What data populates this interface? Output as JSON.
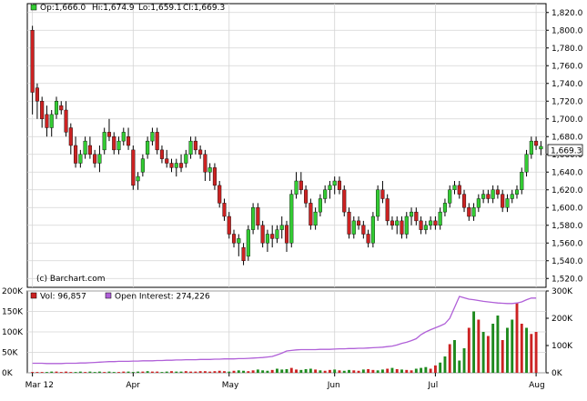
{
  "chart_data": {
    "type": "candlestick",
    "header": {
      "open": "Op:1,666.0",
      "high": "Hi:1,674.9",
      "low": "Lo:1,659.1",
      "close": "Cl:1,669.3"
    },
    "watermark": "(c) Barchart.com",
    "last_price_label": "1,669.3",
    "price_axis": {
      "ylim": [
        1510,
        1830
      ],
      "ticks": [
        1520,
        1540,
        1560,
        1580,
        1600,
        1620,
        1640,
        1660,
        1680,
        1700,
        1720,
        1740,
        1760,
        1780,
        1800,
        1820
      ],
      "tick_labels": [
        "1,520.0",
        "1,540.0",
        "1,560.0",
        "1,580.0",
        "1,600.0",
        "1,620.0",
        "1,640.0",
        "1,660.0",
        "1,680.0",
        "1,700.0",
        "1,720.0",
        "1,740.0",
        "1,760.0",
        "1,780.0",
        "1,800.0",
        "1,820.0"
      ],
      "gridlines": true
    },
    "x_axis": {
      "month_labels": [
        "Mar 12",
        "Apr",
        "May",
        "Jun",
        "Jul",
        "Aug"
      ],
      "month_start_index": [
        0,
        21,
        41,
        63,
        84,
        105
      ]
    },
    "volume_panel": {
      "vol_label": "Vol: 96,857",
      "oi_label": "Open Interest: 274,226",
      "left_ticks": [
        "0K",
        "50K",
        "100K",
        "150K",
        "200K"
      ],
      "left_values": [
        0,
        50000,
        100000,
        150000,
        200000
      ],
      "right_ticks": [
        "0K",
        "100K",
        "200K",
        "300K"
      ],
      "right_values": [
        0,
        100000,
        200000,
        300000
      ],
      "vol_color_up": "#1e8a1e",
      "vol_color_down": "#cc2222",
      "oi_color": "#b060d8"
    },
    "colors": {
      "up": "#33cc33",
      "down": "#cc2222",
      "grid": "#d4d4d4",
      "oi": "#b060d8"
    },
    "candles": [
      [
        1800,
        1805,
        1705,
        1730
      ],
      [
        1735,
        1740,
        1700,
        1720
      ],
      [
        1720,
        1725,
        1690,
        1700
      ],
      [
        1705,
        1715,
        1680,
        1690
      ],
      [
        1690,
        1710,
        1680,
        1705
      ],
      [
        1705,
        1725,
        1700,
        1720
      ],
      [
        1715,
        1720,
        1705,
        1710
      ],
      [
        1710,
        1720,
        1680,
        1685
      ],
      [
        1690,
        1695,
        1660,
        1670
      ],
      [
        1670,
        1680,
        1645,
        1650
      ],
      [
        1650,
        1665,
        1645,
        1660
      ],
      [
        1660,
        1680,
        1655,
        1675
      ],
      [
        1670,
        1680,
        1655,
        1660
      ],
      [
        1660,
        1665,
        1645,
        1650
      ],
      [
        1650,
        1670,
        1640,
        1660
      ],
      [
        1665,
        1690,
        1660,
        1685
      ],
      [
        1685,
        1700,
        1675,
        1680
      ],
      [
        1680,
        1685,
        1660,
        1665
      ],
      [
        1665,
        1680,
        1660,
        1675
      ],
      [
        1675,
        1690,
        1670,
        1685
      ],
      [
        1680,
        1690,
        1665,
        1670
      ],
      [
        1665,
        1670,
        1620,
        1625
      ],
      [
        1630,
        1640,
        1620,
        1635
      ],
      [
        1640,
        1660,
        1635,
        1655
      ],
      [
        1660,
        1680,
        1655,
        1675
      ],
      [
        1675,
        1690,
        1670,
        1685
      ],
      [
        1685,
        1690,
        1660,
        1665
      ],
      [
        1665,
        1670,
        1650,
        1655
      ],
      [
        1655,
        1665,
        1645,
        1650
      ],
      [
        1650,
        1655,
        1640,
        1645
      ],
      [
        1645,
        1655,
        1635,
        1650
      ],
      [
        1650,
        1660,
        1640,
        1645
      ],
      [
        1650,
        1665,
        1645,
        1660
      ],
      [
        1660,
        1680,
        1655,
        1675
      ],
      [
        1675,
        1680,
        1660,
        1665
      ],
      [
        1665,
        1670,
        1655,
        1660
      ],
      [
        1660,
        1665,
        1630,
        1640
      ],
      [
        1640,
        1650,
        1630,
        1645
      ],
      [
        1645,
        1650,
        1620,
        1625
      ],
      [
        1625,
        1630,
        1600,
        1605
      ],
      [
        1605,
        1610,
        1585,
        1590
      ],
      [
        1590,
        1595,
        1565,
        1570
      ],
      [
        1570,
        1575,
        1555,
        1560
      ],
      [
        1560,
        1570,
        1545,
        1565
      ],
      [
        1555,
        1560,
        1535,
        1540
      ],
      [
        1545,
        1580,
        1540,
        1575
      ],
      [
        1575,
        1605,
        1570,
        1600
      ],
      [
        1600,
        1605,
        1575,
        1580
      ],
      [
        1580,
        1585,
        1555,
        1560
      ],
      [
        1560,
        1575,
        1550,
        1570
      ],
      [
        1570,
        1580,
        1555,
        1565
      ],
      [
        1565,
        1580,
        1560,
        1575
      ],
      [
        1575,
        1590,
        1565,
        1580
      ],
      [
        1580,
        1585,
        1550,
        1560
      ],
      [
        1560,
        1620,
        1555,
        1615
      ],
      [
        1615,
        1640,
        1610,
        1630
      ],
      [
        1630,
        1640,
        1615,
        1620
      ],
      [
        1620,
        1625,
        1600,
        1605
      ],
      [
        1605,
        1610,
        1575,
        1580
      ],
      [
        1580,
        1600,
        1575,
        1595
      ],
      [
        1595,
        1615,
        1590,
        1610
      ],
      [
        1610,
        1625,
        1605,
        1620
      ],
      [
        1620,
        1630,
        1610,
        1625
      ],
      [
        1625,
        1635,
        1615,
        1630
      ],
      [
        1630,
        1635,
        1615,
        1620
      ],
      [
        1620,
        1625,
        1590,
        1595
      ],
      [
        1595,
        1600,
        1565,
        1570
      ],
      [
        1570,
        1590,
        1565,
        1585
      ],
      [
        1585,
        1590,
        1575,
        1580
      ],
      [
        1580,
        1585,
        1565,
        1570
      ],
      [
        1570,
        1575,
        1555,
        1560
      ],
      [
        1560,
        1595,
        1555,
        1590
      ],
      [
        1590,
        1625,
        1585,
        1620
      ],
      [
        1620,
        1630,
        1605,
        1610
      ],
      [
        1610,
        1615,
        1580,
        1585
      ],
      [
        1585,
        1590,
        1575,
        1580
      ],
      [
        1580,
        1590,
        1570,
        1585
      ],
      [
        1585,
        1590,
        1565,
        1570
      ],
      [
        1570,
        1595,
        1565,
        1590
      ],
      [
        1590,
        1600,
        1580,
        1595
      ],
      [
        1595,
        1600,
        1580,
        1585
      ],
      [
        1585,
        1590,
        1570,
        1575
      ],
      [
        1575,
        1585,
        1570,
        1580
      ],
      [
        1580,
        1590,
        1575,
        1585
      ],
      [
        1585,
        1590,
        1575,
        1580
      ],
      [
        1580,
        1600,
        1575,
        1595
      ],
      [
        1595,
        1610,
        1590,
        1605
      ],
      [
        1605,
        1625,
        1600,
        1620
      ],
      [
        1620,
        1630,
        1615,
        1625
      ],
      [
        1625,
        1630,
        1610,
        1615
      ],
      [
        1615,
        1620,
        1595,
        1600
      ],
      [
        1600,
        1605,
        1585,
        1590
      ],
      [
        1590,
        1605,
        1585,
        1600
      ],
      [
        1600,
        1615,
        1595,
        1610
      ],
      [
        1610,
        1620,
        1605,
        1615
      ],
      [
        1615,
        1620,
        1605,
        1610
      ],
      [
        1610,
        1625,
        1605,
        1620
      ],
      [
        1620,
        1625,
        1610,
        1615
      ],
      [
        1615,
        1620,
        1595,
        1600
      ],
      [
        1600,
        1615,
        1595,
        1610
      ],
      [
        1610,
        1620,
        1605,
        1615
      ],
      [
        1615,
        1625,
        1610,
        1620
      ],
      [
        1620,
        1645,
        1615,
        1640
      ],
      [
        1640,
        1665,
        1635,
        1660
      ],
      [
        1660,
        1680,
        1655,
        1675
      ],
      [
        1675,
        1680,
        1665,
        1670
      ],
      [
        1666,
        1675,
        1659,
        1669
      ]
    ],
    "volume": [
      2,
      2,
      2,
      2,
      3,
      3,
      2,
      3,
      2,
      2,
      3,
      2,
      3,
      2,
      3,
      2,
      3,
      2,
      2,
      3,
      3,
      2,
      3,
      3,
      4,
      3,
      3,
      2,
      3,
      4,
      3,
      3,
      4,
      3,
      3,
      4,
      4,
      3,
      4,
      5,
      4,
      3,
      5,
      6,
      5,
      4,
      6,
      8,
      6,
      5,
      7,
      10,
      8,
      9,
      12,
      8,
      7,
      9,
      10,
      8,
      6,
      5,
      7,
      8,
      6,
      5,
      7,
      6,
      5,
      8,
      9,
      7,
      6,
      8,
      10,
      12,
      9,
      8,
      7,
      6,
      10,
      12,
      14,
      10,
      18,
      25,
      40,
      70,
      80,
      30,
      60,
      110,
      150,
      130,
      100,
      90,
      120,
      140,
      80,
      110,
      130,
      170,
      120,
      110,
      95,
      100
    ],
    "volume_up": [
      false,
      false,
      false,
      true,
      true,
      false,
      false,
      false,
      false,
      true,
      true,
      false,
      true,
      true,
      true,
      false,
      true,
      true,
      false,
      false,
      true,
      true,
      true,
      false,
      true,
      false,
      false,
      true,
      true,
      false,
      true,
      true,
      false,
      false,
      false,
      false,
      false,
      false,
      false,
      false,
      false,
      true,
      false,
      true,
      true,
      false,
      false,
      true,
      true,
      true,
      false,
      true,
      true,
      true,
      false,
      false,
      true,
      true,
      true,
      false,
      true,
      false,
      false,
      true,
      false,
      true,
      true,
      false,
      false,
      true,
      false,
      false,
      true,
      true,
      false,
      true,
      false,
      true,
      false,
      false,
      true,
      true,
      true,
      false,
      false,
      true,
      true,
      false,
      true,
      true,
      true,
      false,
      true,
      false,
      true,
      false,
      true,
      true,
      false,
      true,
      true,
      false,
      false,
      true,
      false,
      false
    ],
    "open_interest": [
      35,
      35,
      35,
      34,
      34,
      34,
      34,
      35,
      35,
      35,
      36,
      36,
      37,
      38,
      39,
      40,
      41,
      41,
      42,
      42,
      42,
      43,
      43,
      44,
      44,
      44,
      45,
      45,
      46,
      46,
      47,
      47,
      48,
      48,
      48,
      49,
      49,
      49,
      50,
      50,
      51,
      51,
      51,
      52,
      52,
      53,
      54,
      55,
      56,
      58,
      60,
      66,
      72,
      80,
      82,
      84,
      85,
      85,
      85,
      85,
      86,
      86,
      86,
      87,
      88,
      88,
      89,
      89,
      90,
      90,
      91,
      92,
      93,
      94,
      96,
      98,
      102,
      108,
      112,
      118,
      125,
      140,
      150,
      158,
      165,
      172,
      180,
      200,
      240,
      280,
      275,
      270,
      268,
      265,
      262,
      260,
      258,
      256,
      255,
      254,
      254,
      256,
      260,
      268,
      274,
      274
    ]
  }
}
